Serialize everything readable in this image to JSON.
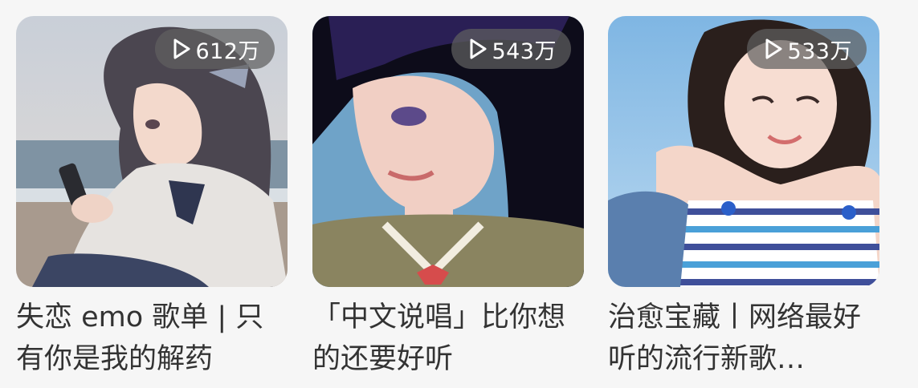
{
  "playlists": [
    {
      "play_count": "612万",
      "title": "失恋 emo 歌单 | 只有你是我的解药",
      "icon": "play-icon"
    },
    {
      "play_count": "543万",
      "title": "「中文说唱」比你想的还要好听",
      "icon": "play-icon"
    },
    {
      "play_count": "533万",
      "title": "治愈宝藏丨网络最好听的流行新歌…",
      "icon": "play-icon"
    }
  ]
}
